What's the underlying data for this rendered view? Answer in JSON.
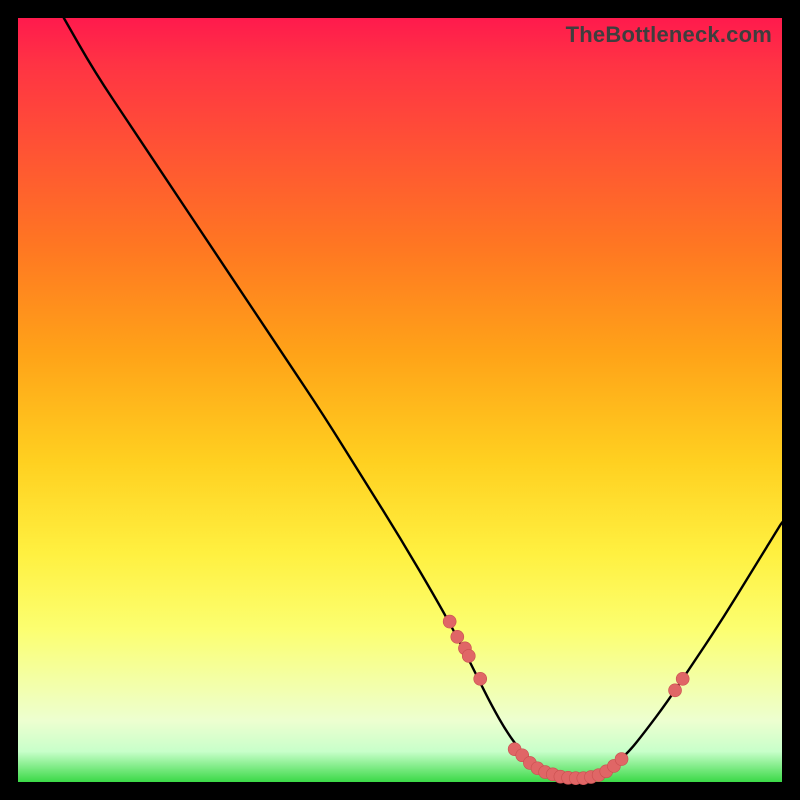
{
  "watermark": "TheBottleneck.com",
  "colors": {
    "page_bg": "#000000",
    "curve": "#000000",
    "marker_fill": "#e06666",
    "marker_stroke": "#c94f4f"
  },
  "chart_data": {
    "type": "line",
    "title": "",
    "xlabel": "",
    "ylabel": "",
    "xlim": [
      0,
      100
    ],
    "ylim": [
      0,
      100
    ],
    "grid": false,
    "gradient_background": true,
    "series": [
      {
        "name": "bottleneck-curve",
        "x": [
          6,
          10,
          15,
          20,
          25,
          30,
          35,
          40,
          45,
          50,
          55,
          58,
          60,
          62,
          64,
          66,
          68,
          70,
          72,
          74,
          76,
          78,
          80,
          82,
          85,
          88,
          92,
          96,
          100
        ],
        "y": [
          100,
          93,
          85.5,
          78,
          70.5,
          63,
          55.5,
          48,
          40,
          32,
          23.5,
          18,
          14,
          10,
          6.5,
          3.8,
          2,
          1,
          0.5,
          0.5,
          1,
          2.2,
          4,
          6.5,
          10.5,
          15,
          21,
          27.5,
          34
        ]
      }
    ],
    "markers": {
      "name": "data-points",
      "x": [
        56.5,
        57.5,
        58.5,
        59,
        60.5,
        65,
        66,
        67,
        68,
        69,
        70,
        71,
        72,
        73,
        74,
        75,
        76,
        77,
        78,
        79,
        86,
        87
      ],
      "y": [
        21,
        19,
        17.5,
        16.5,
        13.5,
        4.3,
        3.5,
        2.5,
        1.8,
        1.3,
        1,
        0.7,
        0.55,
        0.5,
        0.5,
        0.65,
        0.9,
        1.4,
        2.1,
        3.0,
        12,
        13.5
      ]
    }
  }
}
